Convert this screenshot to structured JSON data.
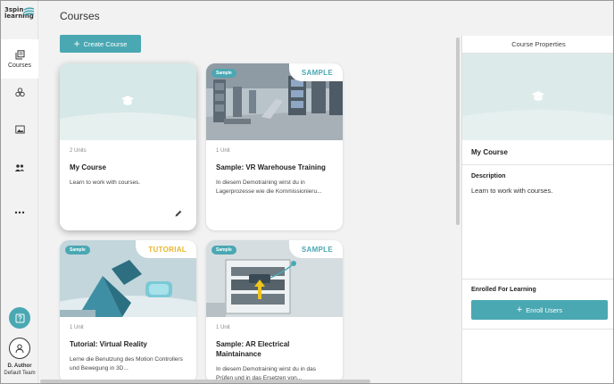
{
  "app": {
    "logo_line1": "3spin",
    "logo_line2": "learning"
  },
  "sidebar": {
    "items": [
      {
        "label": "Courses",
        "icon": "courses-icon"
      },
      {
        "label": "",
        "icon": "modules-icon"
      },
      {
        "label": "",
        "icon": "media-icon"
      },
      {
        "label": "",
        "icon": "users-icon"
      },
      {
        "label": "",
        "icon": "more-icon"
      }
    ],
    "user_name": "D. Author",
    "user_team": "Default Team"
  },
  "main": {
    "title": "Courses",
    "create_label": "Create Course"
  },
  "cards": [
    {
      "units": "2 Units",
      "title": "My Course",
      "desc": "Learn to work with courses.",
      "chip": "",
      "ribbon": ""
    },
    {
      "units": "1 Unit",
      "title": "Sample: VR Warehouse Training",
      "desc": "In diesem Demotraining wirst du in Lagerprozesse wie die Kommissionieru...",
      "chip": "Sample",
      "ribbon": "SAMPLE"
    },
    {
      "units": "1 Unit",
      "title": "Tutorial: Virtual Reality",
      "desc": "Lerne die Benutzung des Motion Controllers und Bewegung in 3D...",
      "chip": "Sample",
      "ribbon": "TUTORIAL"
    },
    {
      "units": "1 Unit",
      "title": "Sample: AR Electrical Maintainance",
      "desc": "In diesem Demotraining wirst du in das Prüfen und in das Ersetzen von...",
      "chip": "Sample",
      "ribbon": "SAMPLE"
    }
  ],
  "panel": {
    "header": "Course Properties",
    "course_name": "My Course",
    "desc_title": "Description",
    "desc_text": "Learn to work with courses.",
    "enroll_title": "Enrolled For Learning",
    "enroll_label": "Enroll Users"
  },
  "colors": {
    "accent": "#4aa8b3",
    "tutorial": "#e8b52a",
    "sample": "#4aa8b3"
  }
}
